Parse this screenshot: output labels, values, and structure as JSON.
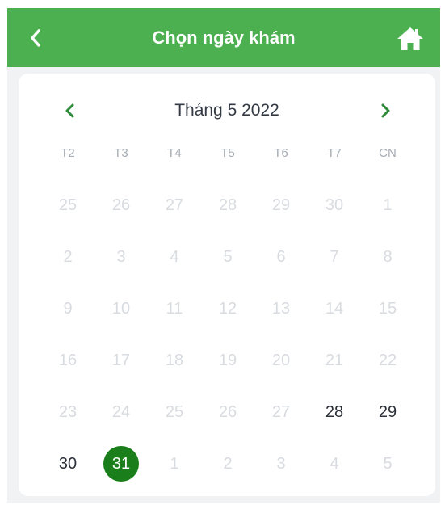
{
  "header": {
    "title": "Chọn ngày khám",
    "back_icon": "chevron-left-icon",
    "home_icon": "home-icon",
    "color": "#4caf50"
  },
  "calendar": {
    "month_label": "Tháng 5 2022",
    "prev_icon": "chevron-left-icon",
    "next_icon": "chevron-right-icon",
    "accent_color": "#2e8b3a",
    "selected_color": "#1a7f1a",
    "weekdays": [
      "T2",
      "T3",
      "T4",
      "T5",
      "T6",
      "T7",
      "CN"
    ],
    "selected_day": "31",
    "weeks": [
      [
        {
          "d": "25",
          "enabled": false
        },
        {
          "d": "26",
          "enabled": false
        },
        {
          "d": "27",
          "enabled": false
        },
        {
          "d": "28",
          "enabled": false
        },
        {
          "d": "29",
          "enabled": false
        },
        {
          "d": "30",
          "enabled": false
        },
        {
          "d": "1",
          "enabled": false
        }
      ],
      [
        {
          "d": "2",
          "enabled": false
        },
        {
          "d": "3",
          "enabled": false
        },
        {
          "d": "4",
          "enabled": false
        },
        {
          "d": "5",
          "enabled": false
        },
        {
          "d": "6",
          "enabled": false
        },
        {
          "d": "7",
          "enabled": false
        },
        {
          "d": "8",
          "enabled": false
        }
      ],
      [
        {
          "d": "9",
          "enabled": false
        },
        {
          "d": "10",
          "enabled": false
        },
        {
          "d": "11",
          "enabled": false
        },
        {
          "d": "12",
          "enabled": false
        },
        {
          "d": "13",
          "enabled": false
        },
        {
          "d": "14",
          "enabled": false
        },
        {
          "d": "15",
          "enabled": false
        }
      ],
      [
        {
          "d": "16",
          "enabled": false
        },
        {
          "d": "17",
          "enabled": false
        },
        {
          "d": "18",
          "enabled": false
        },
        {
          "d": "19",
          "enabled": false
        },
        {
          "d": "20",
          "enabled": false
        },
        {
          "d": "21",
          "enabled": false
        },
        {
          "d": "22",
          "enabled": false
        }
      ],
      [
        {
          "d": "23",
          "enabled": false
        },
        {
          "d": "24",
          "enabled": false
        },
        {
          "d": "25",
          "enabled": false
        },
        {
          "d": "26",
          "enabled": false
        },
        {
          "d": "27",
          "enabled": false
        },
        {
          "d": "28",
          "enabled": true
        },
        {
          "d": "29",
          "enabled": true
        }
      ],
      [
        {
          "d": "30",
          "enabled": true
        },
        {
          "d": "31",
          "enabled": true,
          "selected": true
        },
        {
          "d": "1",
          "enabled": false
        },
        {
          "d": "2",
          "enabled": false
        },
        {
          "d": "3",
          "enabled": false
        },
        {
          "d": "4",
          "enabled": false
        },
        {
          "d": "5",
          "enabled": false
        }
      ]
    ]
  }
}
